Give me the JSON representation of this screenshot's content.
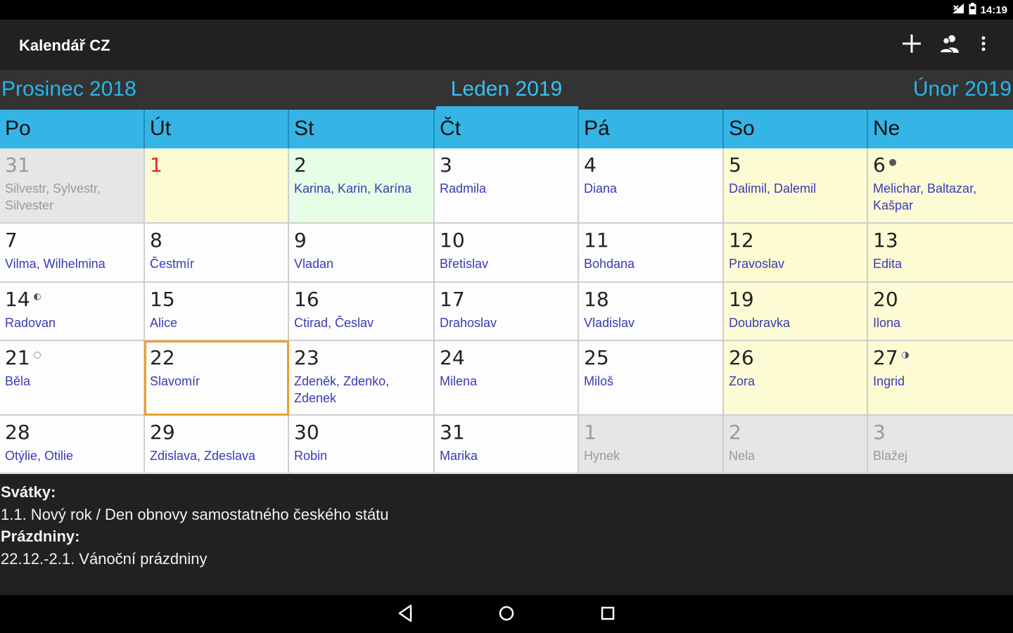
{
  "status": {
    "time": "14:19",
    "icons": [
      "signal-icon",
      "battery-icon"
    ]
  },
  "app": {
    "title": "Kalendář CZ",
    "actions": [
      "add-icon",
      "contacts-icon",
      "more-vert-icon"
    ]
  },
  "month_nav": {
    "prev": "Prosinec 2018",
    "current": "Leden 2019",
    "next": "Únor 2019"
  },
  "weekdays": [
    "Po",
    "Út",
    "St",
    "Čt",
    "Pá",
    "So",
    "Ne"
  ],
  "weeks": [
    [
      {
        "day": "31",
        "names": "Silvestr, Sylvestr, Silvester",
        "bg": "grey",
        "other": true
      },
      {
        "day": "1",
        "names": "",
        "bg": "yellow",
        "holiday": true
      },
      {
        "day": "2",
        "names": "Karina, Karin, Karína",
        "bg": "green"
      },
      {
        "day": "3",
        "names": "Radmila",
        "bg": "white"
      },
      {
        "day": "4",
        "names": "Diana",
        "bg": "white"
      },
      {
        "day": "5",
        "names": "Dalimil, Dalemil",
        "bg": "yellow"
      },
      {
        "day": "6",
        "names": "Melichar, Baltazar, Kašpar",
        "bg": "yellow",
        "moon": "new-moon"
      }
    ],
    [
      {
        "day": "7",
        "names": "Vilma, Wilhelmina",
        "bg": "white"
      },
      {
        "day": "8",
        "names": "Čestmír",
        "bg": "white"
      },
      {
        "day": "9",
        "names": "Vladan",
        "bg": "white"
      },
      {
        "day": "10",
        "names": "Břetislav",
        "bg": "white"
      },
      {
        "day": "11",
        "names": "Bohdana",
        "bg": "white"
      },
      {
        "day": "12",
        "names": "Pravoslav",
        "bg": "yellow"
      },
      {
        "day": "13",
        "names": "Edita",
        "bg": "yellow"
      }
    ],
    [
      {
        "day": "14",
        "names": "Radovan",
        "bg": "white",
        "moon": "first-quarter"
      },
      {
        "day": "15",
        "names": "Alice",
        "bg": "white"
      },
      {
        "day": "16",
        "names": "Ctirad, Česlav",
        "bg": "white"
      },
      {
        "day": "17",
        "names": "Drahoslav",
        "bg": "white"
      },
      {
        "day": "18",
        "names": "Vladislav",
        "bg": "white"
      },
      {
        "day": "19",
        "names": "Doubravka",
        "bg": "yellow"
      },
      {
        "day": "20",
        "names": "Ilona",
        "bg": "yellow"
      }
    ],
    [
      {
        "day": "21",
        "names": "Běla",
        "bg": "white",
        "moon": "full-moon"
      },
      {
        "day": "22",
        "names": "Slavomír",
        "bg": "white",
        "today": true
      },
      {
        "day": "23",
        "names": "Zdeněk, Zdenko, Zdenek",
        "bg": "white"
      },
      {
        "day": "24",
        "names": "Milena",
        "bg": "white"
      },
      {
        "day": "25",
        "names": "Miloš",
        "bg": "white"
      },
      {
        "day": "26",
        "names": "Zora",
        "bg": "yellow"
      },
      {
        "day": "27",
        "names": "Ingrid",
        "bg": "yellow",
        "moon": "last-quarter"
      }
    ],
    [
      {
        "day": "28",
        "names": "Otýlie, Otilie",
        "bg": "white"
      },
      {
        "day": "29",
        "names": "Zdislava, Zdeslava",
        "bg": "white"
      },
      {
        "day": "30",
        "names": "Robin",
        "bg": "white"
      },
      {
        "day": "31",
        "names": "Marika",
        "bg": "white"
      },
      {
        "day": "1",
        "names": "Hynek",
        "bg": "grey",
        "other": true
      },
      {
        "day": "2",
        "names": "Nela",
        "bg": "grey",
        "other": true
      },
      {
        "day": "3",
        "names": "Blažej",
        "bg": "grey",
        "other": true
      }
    ]
  ],
  "info": {
    "holidays_label": "Svátky:",
    "holidays_text": "1.1. Nový rok / Den obnovy samostatného českého státu",
    "vacation_label": "Prázdniny:",
    "vacation_text": "22.12.-2.1. Vánoční prázdniny"
  },
  "colors": {
    "accent": "#35b5e5",
    "today_border": "#e8a030",
    "weekend_bg": "#fdfbd3",
    "name_text": "#3a3ab8"
  },
  "navbar": [
    "back-icon",
    "home-icon",
    "recents-icon"
  ]
}
